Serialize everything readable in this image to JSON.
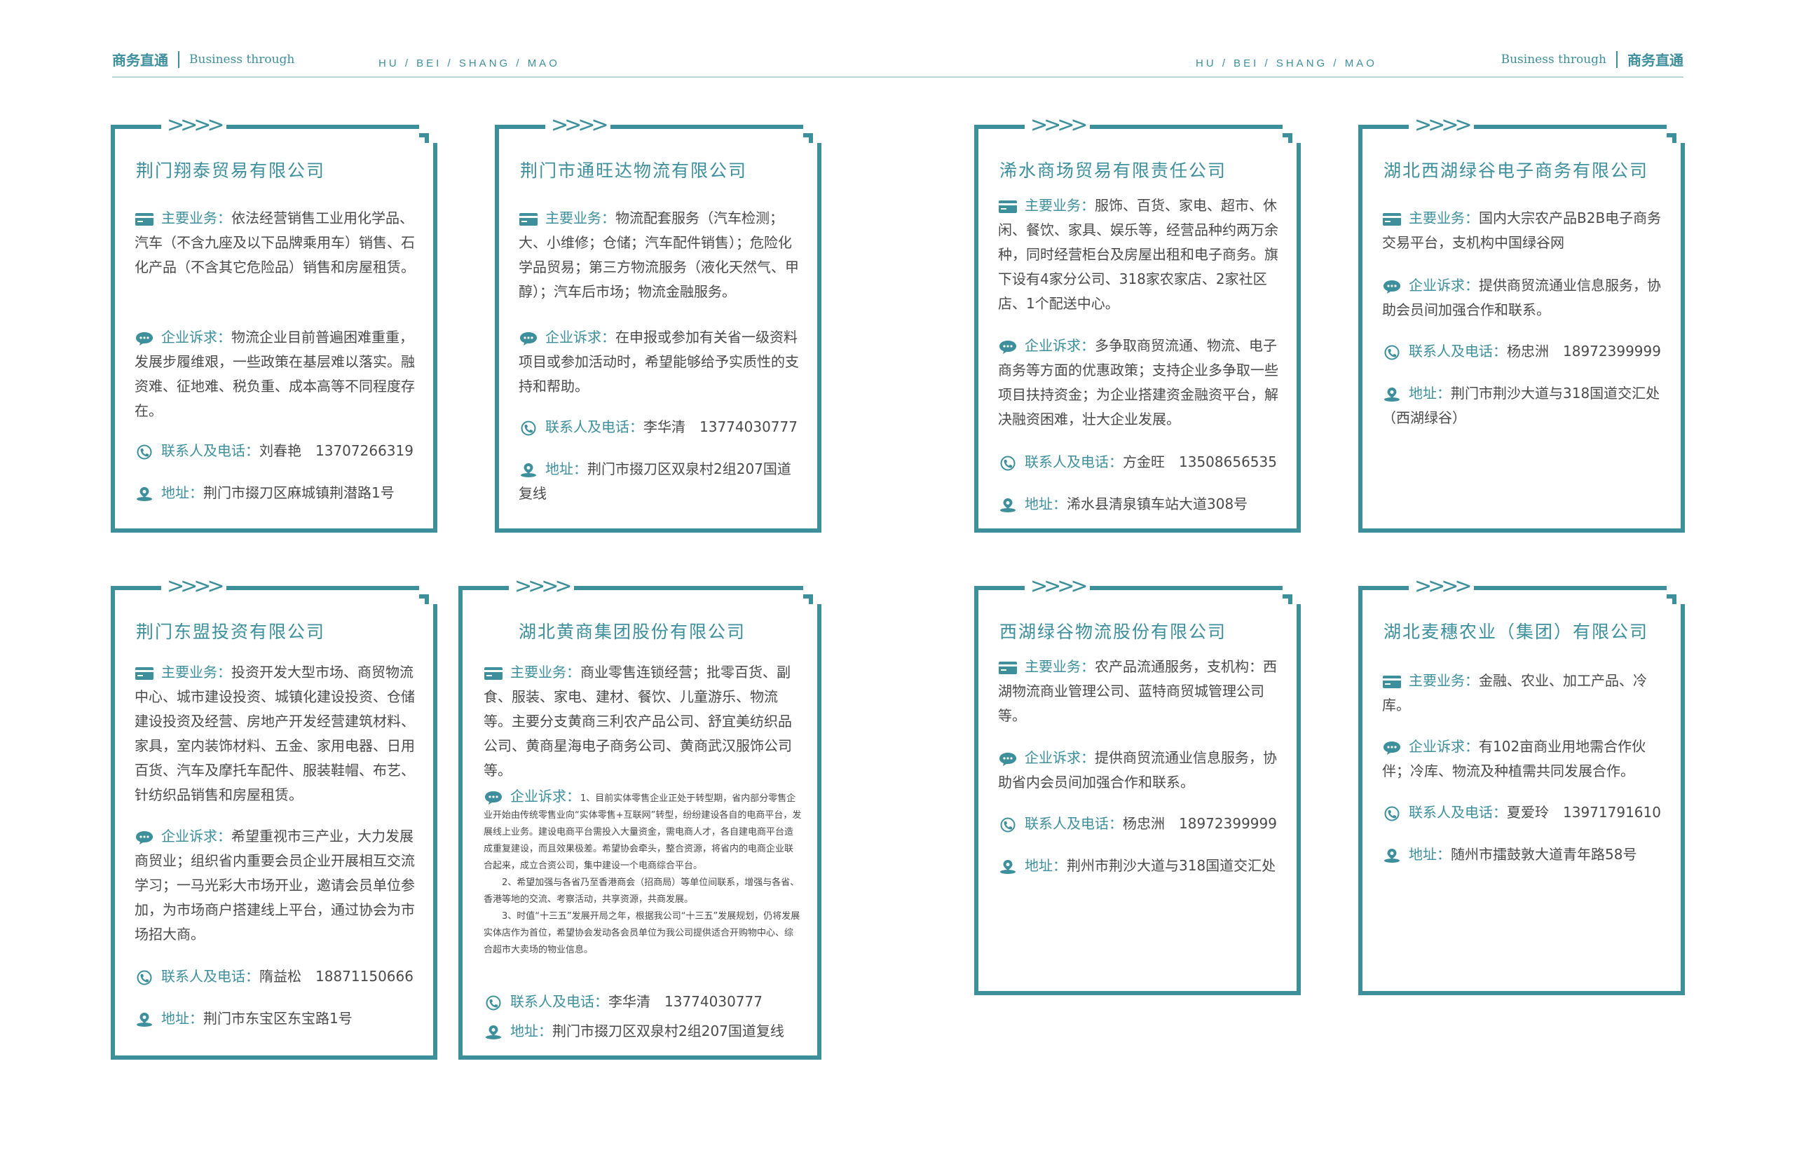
{
  "header": {
    "left_cn": "商务直通",
    "left_en": "Business through",
    "hubei_left": "HU / BEI / SHANG / MAO",
    "hubei_right": "HU / BEI / SHANG / MAO",
    "right_en": "Business through",
    "right_cn": "商务直通"
  },
  "chevrons": ">>>>",
  "labels": {
    "business": "主要业务：",
    "appeal": "企业诉求：",
    "contact": "联系人及电话：",
    "address": "地址："
  },
  "icons": {
    "business": "card-icon",
    "appeal": "chat-bubble-icon",
    "contact": "phone-icon",
    "address": "location-pin-icon"
  },
  "accent_color": "#3e8f9c",
  "cards": [
    {
      "title": "荆门翔泰贸易有限公司",
      "business": "依法经营销售工业用化学品、汽车（不含九座及以下品牌乘用车）销售、石化产品（不含其它危险品）销售和房屋租赁。",
      "appeal": "物流企业目前普遍困难重重，发展步履维艰，一些政策在基层难以落实。融资难、征地难、税负重、成本高等不同程度存在。",
      "contact": "刘春艳　13707266319",
      "address": "荆门市掇刀区麻城镇荆潜路1号"
    },
    {
      "title": "荆门市通旺达物流有限公司",
      "business": "物流配套服务（汽车检测；大、小维修；仓储；汽车配件销售）；危险化学品贸易；第三方物流服务（液化天然气、甲醇）；汽车后市场；物流金融服务。",
      "appeal": "在申报或参加有关省一级资料项目或参加活动时，希望能够给予实质性的支持和帮助。",
      "contact": "李华清　13774030777",
      "address": "荆门市掇刀区双泉村2组207国道复线"
    },
    {
      "title": "浠水商场贸易有限责任公司",
      "business": "服饰、百货、家电、超市、休闲、餐饮、家具、娱乐等，经营品种约两万余种，同时经营柜台及房屋出租和电子商务。旗下设有4家分公司、318家农家店、2家社区店、1个配送中心。",
      "appeal": "多争取商贸流通、物流、电子商务等方面的优惠政策；支持企业多争取一些项目扶持资金；为企业搭建资金融资平台，解决融资困难，壮大企业发展。",
      "contact": "方金旺　13508656535",
      "address": "浠水县清泉镇车站大道308号"
    },
    {
      "title": "湖北西湖绿谷电子商务有限公司",
      "business": "国内大宗农产品B2B电子商务交易平台，支机构中国绿谷网",
      "appeal": "提供商贸流通业信息服务，协助会员间加强合作和联系。",
      "contact": "杨忠洲　18972399999",
      "address": "荆门市荆沙大道与318国道交汇处（西湖绿谷）"
    },
    {
      "title": "荆门东盟投资有限公司",
      "business": "投资开发大型市场、商贸物流中心、城市建设投资、城镇化建设投资、仓储建设投资及经营、房地产开发经营建筑材料、家具，室内装饰材料、五金、家用电器、日用百货、汽车及摩托车配件、服装鞋帽、布艺、针纺织品销售和房屋租赁。",
      "appeal": "希望重视市三产业，大力发展商贸业；组织省内重要会员企业开展相互交流学习；一马光彩大市场开业，邀请会员单位参加，为市场商户搭建线上平台，通过协会为市场招大商。",
      "contact": "隋益松　18871150666",
      "address": "荆门市东宝区东宝路1号"
    },
    {
      "title": "湖北黄商集团股份有限公司",
      "business": "商业零售连锁经营；批零百货、副食、服装、家电、建材、餐饮、儿童游乐、物流等。主要分支黄商三利农产品公司、舒宜美纺织品公司、黄商星海电子商务公司、黄商武汉服饰公司等。",
      "appeal_paras": [
        "1、目前实体零售企业正处于转型期，省内部分零售企业开始由传统零售业向“实体零售+互联网”转型，纷纷建设各自的电商平台，发展线上业务。建设电商平台需投入大量资金，需电商人才，各自建电商平台造成重复建设，而且效果极差。希望协会牵头，整合资源，将省内的电商企业联合起来，成立合资公司，集中建设一个电商综合平台。",
        "2、希望加强与各省乃至香港商会（招商局）等单位间联系，增强与各省、香港等地的交流、考察活动，共享资源，共商发展。",
        "3、时值“十三五”发展开局之年，根据我公司“十三五”发展规划，仍将发展实体店作为首位，希望协会发动各会员单位为我公司提供适合开购物中心、综合超市大卖场的物业信息。"
      ],
      "contact": "李华清　13774030777",
      "address": "荆门市掇刀区双泉村2组207国道复线"
    },
    {
      "title": "西湖绿谷物流股份有限公司",
      "business": "农产品流通服务，支机构：西湖物流商业管理公司、蓝特商贸城管理公司等。",
      "appeal": "提供商贸流通业信息服务，协助省内会员间加强合作和联系。",
      "contact": "杨忠洲　18972399999",
      "address": "荆州市荆沙大道与318国道交汇处"
    },
    {
      "title": "湖北麦穗农业（集团）有限公司",
      "business": "金融、农业、加工产品、冷库。",
      "appeal": "有102亩商业用地需合作伙伴；冷库、物流及种植需共同发展合作。",
      "contact": "夏爱玲　13971791610",
      "address": "随州市擂鼓敦大道青年路58号"
    }
  ]
}
